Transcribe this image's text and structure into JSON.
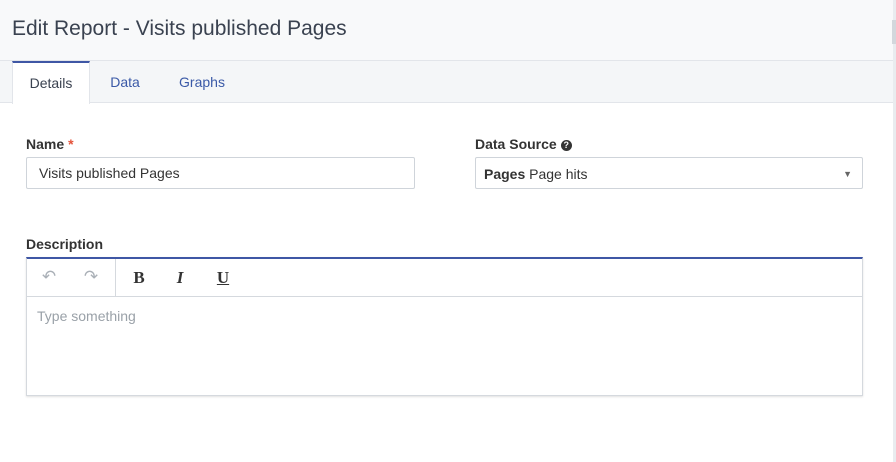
{
  "header": {
    "title": "Edit Report - Visits published Pages"
  },
  "tabs": [
    {
      "label": "Details",
      "active": true
    },
    {
      "label": "Data",
      "active": false
    },
    {
      "label": "Graphs",
      "active": false
    }
  ],
  "form": {
    "name": {
      "label": "Name",
      "required_mark": "*",
      "value": "Visits published Pages"
    },
    "data_source": {
      "label": "Data Source",
      "help_icon": "question-circle-icon",
      "selected_group": "Pages",
      "selected_value": "Page hits"
    },
    "description": {
      "label": "Description",
      "placeholder": "Type something",
      "toolbar": {
        "undo": "undo-icon",
        "redo": "redo-icon",
        "bold": "B",
        "italic": "I",
        "underline": "U"
      }
    }
  },
  "colors": {
    "accent": "#3f57a5",
    "link": "#3a59a7",
    "required": "#e4533a"
  }
}
